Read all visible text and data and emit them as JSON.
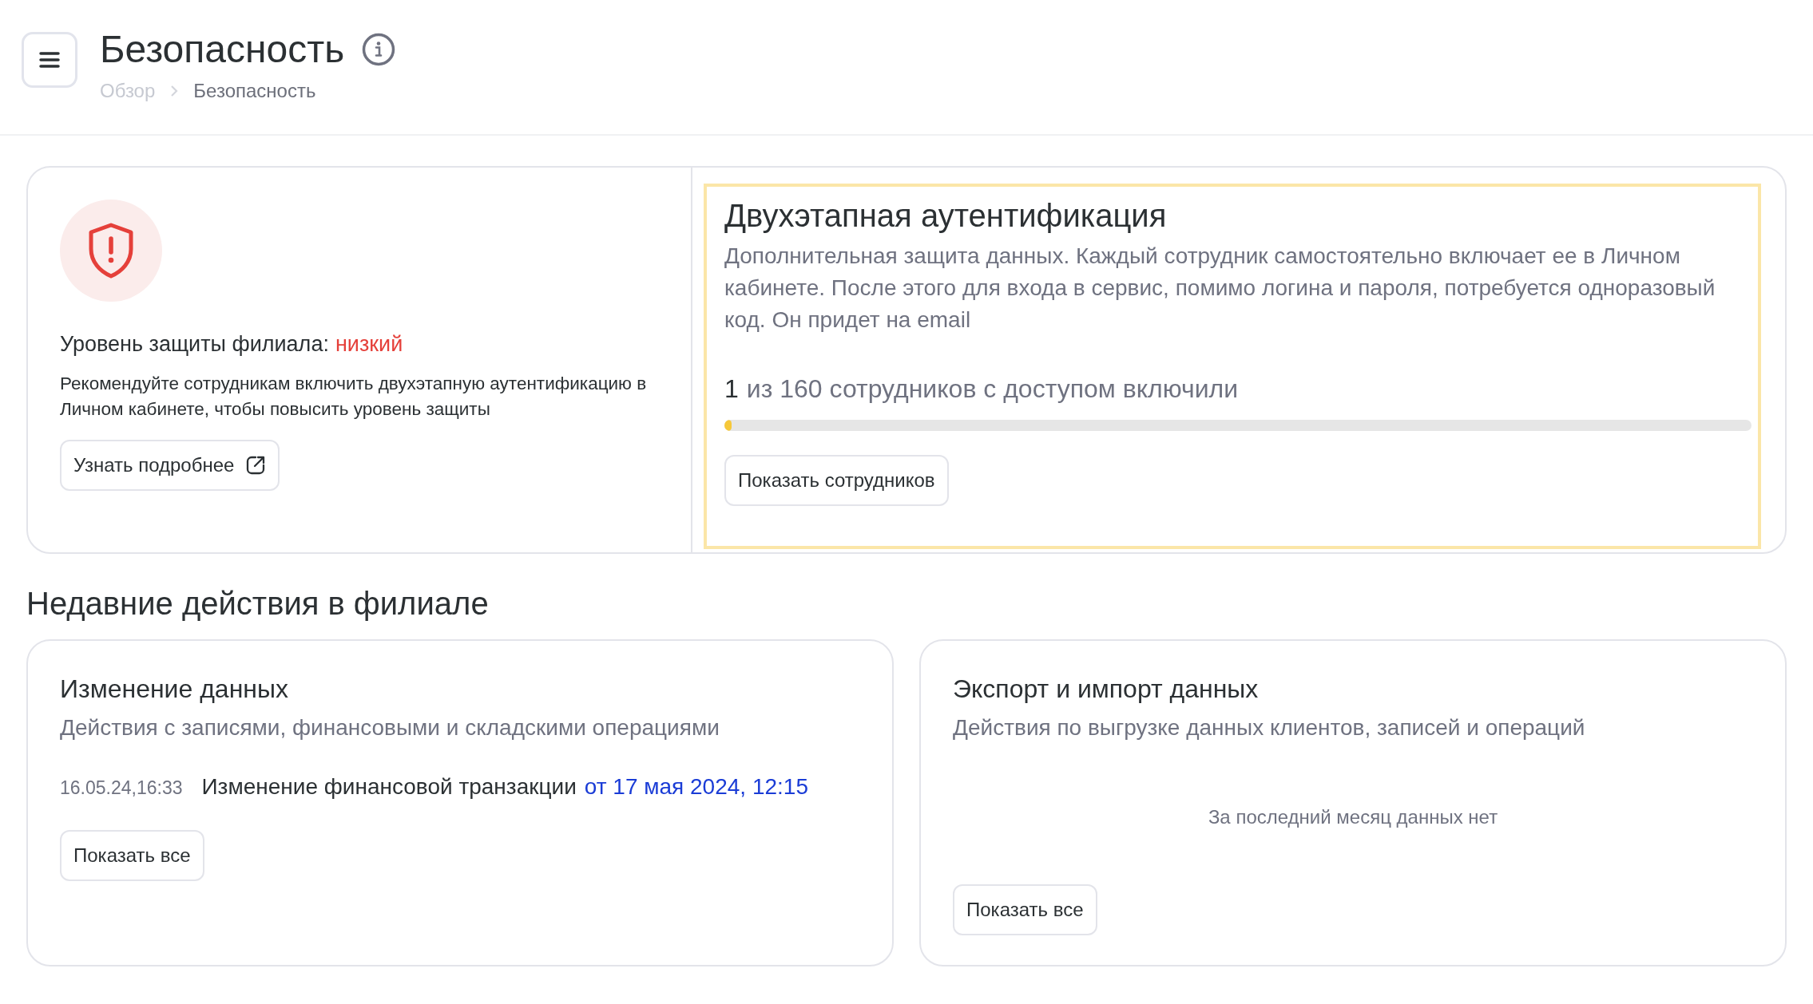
{
  "header": {
    "title": "Безопасность",
    "breadcrumbs": [
      {
        "label": "Обзор",
        "current": false
      },
      {
        "label": "Безопасность",
        "current": true
      }
    ]
  },
  "protection": {
    "label": "Уровень защиты филиала:",
    "value": "низкий",
    "description": "Рекомендуйте сотрудникам включить двухэтапную аутентификацию в Личном кабинете, чтобы повысить уровень защиты",
    "button": "Узнать подробнее"
  },
  "two_factor": {
    "title": "Двухэтапная аутентификация",
    "description": "Дополнительная защита данных. Каждый сотрудник самостоятельно включает ее в Личном кабинете. После этого для входа в сервис, помимо логина и пароля, потребуется одноразовый код. Он придет на email",
    "count": "1",
    "count_label": "из 160 сотрудников с доступом включили",
    "level": 0.007,
    "button": "Показать сотрудников"
  },
  "recent": {
    "title": "Недавние действия в филиале",
    "cards": [
      {
        "title": "Изменение данных",
        "subtitle": "Действия с записями, финансовыми и складскими операциями",
        "entries": [
          {
            "time": "16.05.24,16:33",
            "text": "Изменение финансовой транзакции",
            "link": "от 17 мая 2024, 12:15"
          }
        ],
        "button": "Показать все"
      },
      {
        "title": "Экспорт и импорт данных",
        "subtitle": "Действия по выгрузке данных клиентов, записей и операций",
        "empty": "За последний месяц данных нет",
        "button": "Показать все"
      }
    ]
  }
}
